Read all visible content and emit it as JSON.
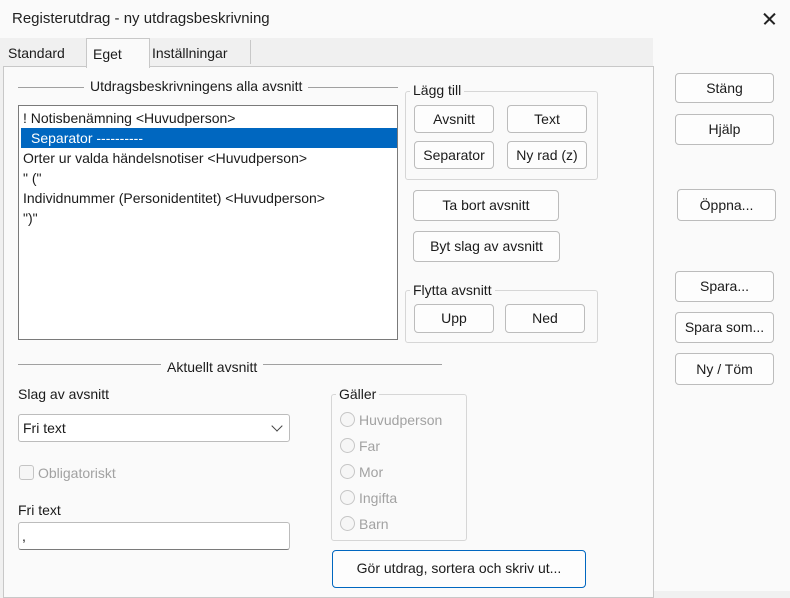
{
  "window": {
    "title": "Registerutdrag - ny utdragsbeskrivning"
  },
  "tabs": [
    {
      "label": "Standard"
    },
    {
      "label": "Eget"
    },
    {
      "label": "Inställningar"
    }
  ],
  "sections": {
    "all_sections_title": "Utdragsbeskrivningens alla avsnitt",
    "current_section_title": "Aktuellt avsnitt"
  },
  "section_list": {
    "items": [
      "! Notisbenämning <Huvudperson>",
      "Separator ----------",
      "Orter ur valda händelsnotiser <Huvudperson>",
      "\" (\"",
      "Individnummer (Personidentitet) <Huvudperson>",
      "\")\""
    ],
    "selected_index": 1
  },
  "add_group": {
    "title": "Lägg till",
    "avsnitt": "Avsnitt",
    "text": "Text",
    "separator": "Separator",
    "new_row": "Ny rad (z)"
  },
  "actions": {
    "remove": "Ta bort avsnitt",
    "change_type": "Byt slag av avsnitt",
    "run": "Gör utdrag, sortera och skriv ut..."
  },
  "move_group": {
    "title": "Flytta avsnitt",
    "up": "Upp",
    "down": "Ned"
  },
  "current": {
    "type_label": "Slag av avsnitt",
    "type_value": "Fri text",
    "mandatory_label": "Obligatoriskt",
    "mandatory_checked": false,
    "free_text_label": "Fri text",
    "free_text_value": ","
  },
  "applies": {
    "title": "Gäller",
    "options": [
      "Huvudperson",
      "Far",
      "Mor",
      "Ingifta",
      "Barn"
    ],
    "enabled": false
  },
  "side_buttons": {
    "close": "Stäng",
    "help": "Hjälp",
    "open": "Öppna...",
    "save": "Spara...",
    "save_as": "Spara som...",
    "new_clear": "Ny / Töm"
  }
}
